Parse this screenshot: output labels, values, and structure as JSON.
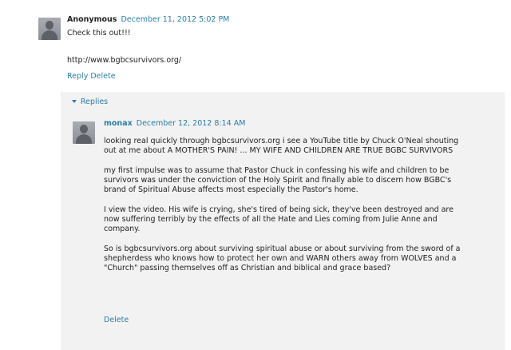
{
  "comment": {
    "author": "Anonymous",
    "date": "December 11, 2012 5:02 PM",
    "body": "Check this out!!!",
    "url": "http://www.bgbcsurvivors.org/",
    "reply_label": "Reply",
    "delete_label": "Delete"
  },
  "replies": {
    "toggle_label": "Replies",
    "items": [
      {
        "author": "monax",
        "date": "December 12, 2012 8:14 AM",
        "paragraphs": [
          {
            "line1": "looking real quickly through bgbcsurvivors.org i see a YouTube title by Chuck O'Neal shouting",
            "line2": "out at me about A MOTHER'S PAIN! ... MY WIFE AND CHILDREN ARE TRUE BGBC SURVIVORS"
          },
          {
            "line1": "my first impulse was to assume that Pastor Chuck in confessing his wife and children to be",
            "line2": "survivors was under the conviction of the Holy Spirit and finally able to discern how BGBC's",
            "line3": "brand of Spiritual Abuse affects most especially the Pastor's home."
          },
          {
            "line1": "I view the video. His wife is crying, she's tired of being sick, they've been destroyed and are",
            "line2": "now suffering terribly by the effects of all the Hate and Lies coming from Julie Anne and",
            "line3": "company."
          },
          {
            "line1": "So is bgbcsurvivors.org about surviving spiritual abuse or about surviving from the sword of a",
            "line2": "shepherdess who knows how to protect her own and WARN others away from WOLVES and a",
            "line3": "\"Church\" passing themselves off as Christian and biblical and grace based?"
          }
        ],
        "delete_label": "Delete"
      }
    ]
  }
}
